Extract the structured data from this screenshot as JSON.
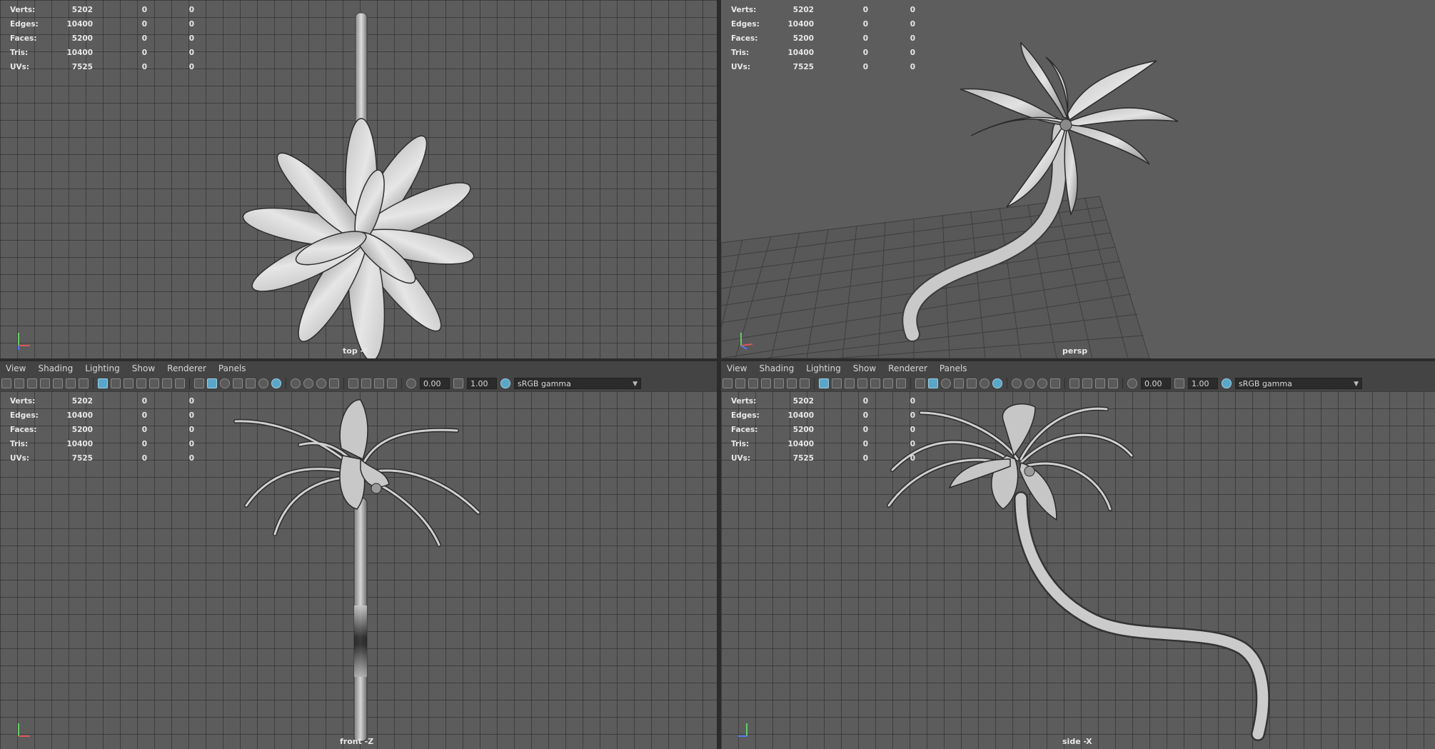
{
  "stats": [
    {
      "label": "Verts:",
      "v1": "5202",
      "v2": "0",
      "v3": "0"
    },
    {
      "label": "Edges:",
      "v1": "10400",
      "v2": "0",
      "v3": "0"
    },
    {
      "label": "Faces:",
      "v1": "5200",
      "v2": "0",
      "v3": "0"
    },
    {
      "label": "Tris:",
      "v1": "10400",
      "v2": "0",
      "v3": "0"
    },
    {
      "label": "UVs:",
      "v1": "7525",
      "v2": "0",
      "v3": "0"
    }
  ],
  "viewports": {
    "top": {
      "label": "top -Y"
    },
    "persp": {
      "label": "persp"
    },
    "front": {
      "label": "front -Z"
    },
    "side": {
      "label": "side -X"
    }
  },
  "menu": [
    "View",
    "Shading",
    "Lighting",
    "Show",
    "Renderer",
    "Panels"
  ],
  "toolbar": {
    "exposure": "0.00",
    "gamma": "1.00",
    "color_space": "sRGB gamma"
  },
  "axis": {
    "x": "x",
    "y": "y",
    "z": "z"
  },
  "colors": {
    "accent": "#5aa6c8",
    "viewport_bg": "#5c5c5c",
    "grid": "#3a3a3a"
  }
}
